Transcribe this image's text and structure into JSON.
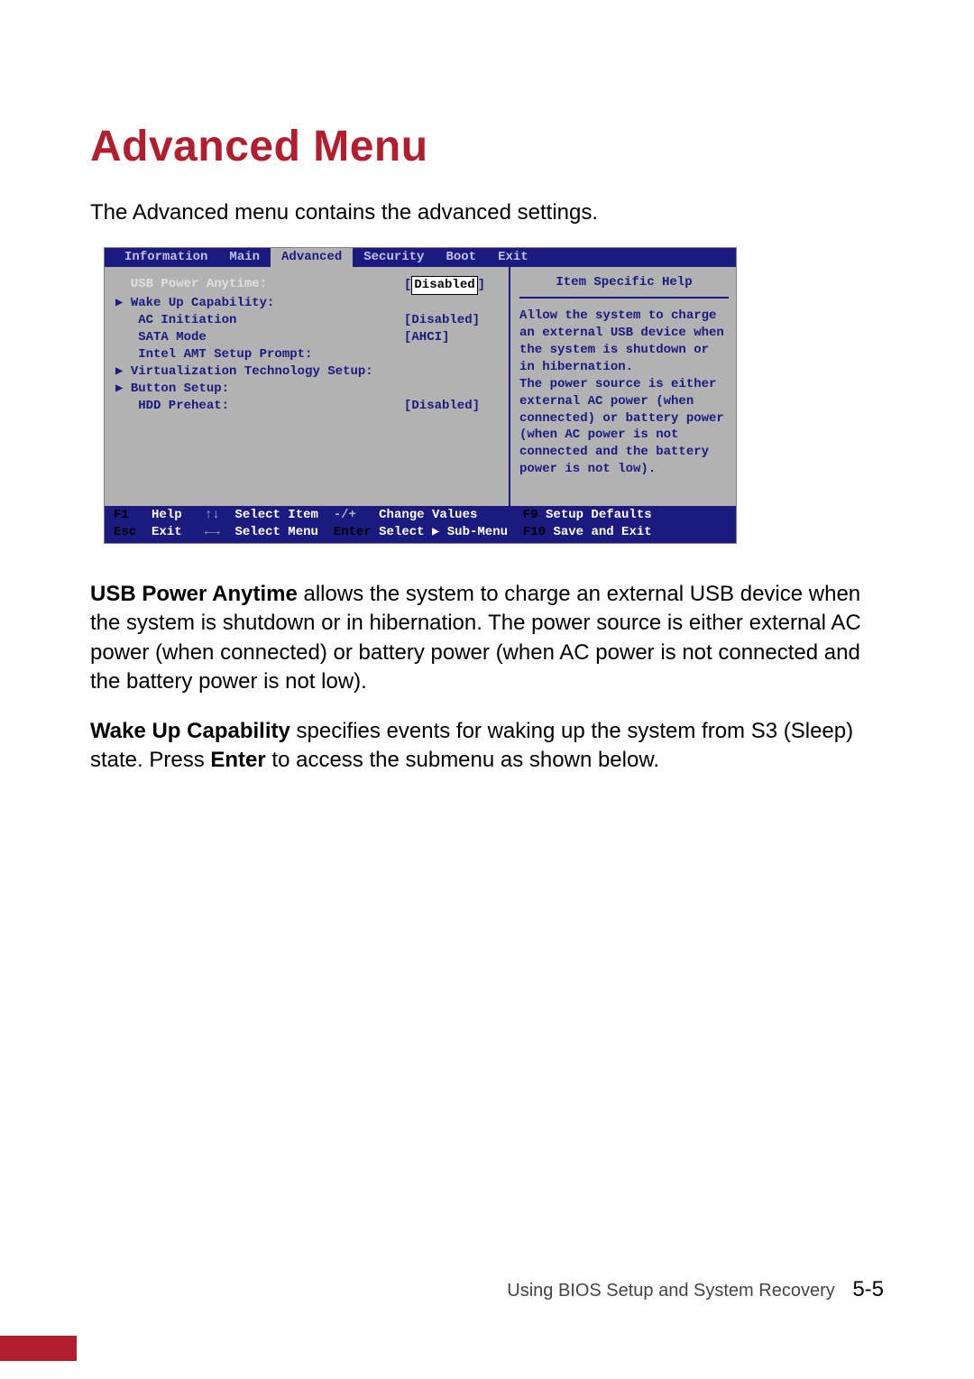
{
  "heading": "Advanced Menu",
  "intro": "The Advanced menu contains the advanced settings.",
  "bios": {
    "tabs": [
      "Information",
      "Main",
      "Advanced",
      "Security",
      "Boot",
      "Exit"
    ],
    "active_tab_index": 2,
    "selected_item": {
      "label": "  USB Power Anytime:",
      "value": "Disabled"
    },
    "items": [
      {
        "label": "▶ Wake Up Capability:",
        "value": ""
      },
      {
        "label": "   AC Initiation",
        "value": "[Disabled]"
      },
      {
        "label": "   SATA Mode",
        "value": "[AHCI]"
      },
      {
        "label": "   Intel AMT Setup Prompt:",
        "value": ""
      },
      {
        "label": "▶ Virtualization Technology Setup:",
        "value": ""
      },
      {
        "label": "▶ Button Setup:",
        "value": ""
      },
      {
        "label": "   HDD Preheat:",
        "value": "[Disabled]"
      }
    ],
    "help_title": "Item Specific Help",
    "help_text": "Allow the system to charge an external USB device when the system is shutdown or in hibernation.\nThe power source is either external AC power (when connected) or battery power (when AC power is not connected and the battery power is not low).",
    "footer": {
      "row1": {
        "k1": "F1",
        "l1": "Help",
        "k2": "↑↓",
        "l2": "Select Item",
        "k3": "-/+",
        "l3": "Change Values",
        "k4": "F9",
        "l4": "Setup Defaults"
      },
      "row2": {
        "k1": "Esc",
        "l1": "Exit",
        "k2": "←→",
        "l2": "Select Menu",
        "k3": "Enter",
        "l3": "Select ▶ Sub-Menu",
        "k4": "F10",
        "l4": "Save and Exit"
      }
    }
  },
  "para1": {
    "bold": "USB Power Anytime",
    "text": "  allows the system to charge an external USB device when the system is shutdown or in hibernation. The power source is either external AC power (when connected) or battery power (when AC power is not connected and the battery power is not low)."
  },
  "para2": {
    "bold1": "Wake Up Capability",
    "mid": "  specifies events for waking up the system from S3 (Sleep) state. Press ",
    "bold2": "Enter",
    "tail": " to access the submenu as shown below."
  },
  "footer": {
    "text": "Using BIOS Setup and System Recovery",
    "page": "5-5"
  }
}
